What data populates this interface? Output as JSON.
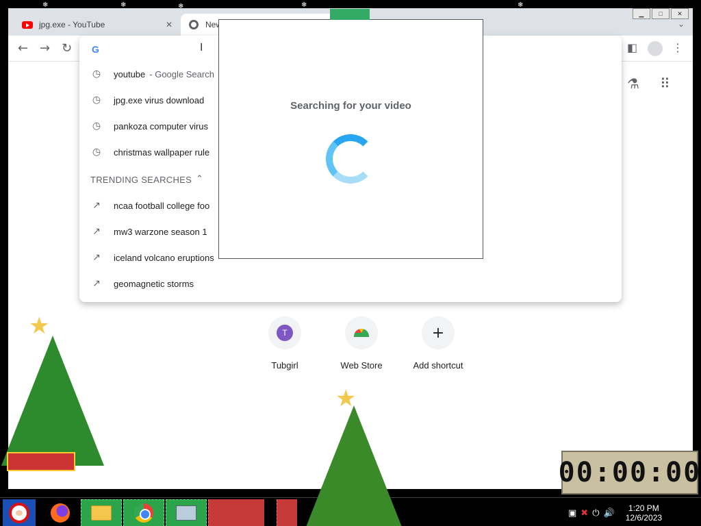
{
  "browser": {
    "tabs": [
      {
        "label": "jpg.exe - YouTube"
      },
      {
        "label": "New"
      }
    ]
  },
  "omnibox": {
    "suggestions": [
      {
        "text": "youtube",
        "sub": "- Google Search"
      },
      {
        "text": "jpg.exe virus download"
      },
      {
        "text": "pankoza computer virus"
      },
      {
        "text": "christmas wallpaper rule"
      }
    ],
    "trending_header": "TRENDING SEARCHES",
    "trending": [
      {
        "text": "ncaa football college foo"
      },
      {
        "text": "mw3 warzone season 1"
      },
      {
        "text": "iceland volcano eruptions"
      },
      {
        "text": "geomagnetic storms"
      }
    ]
  },
  "ntp": {
    "shortcuts": [
      {
        "label": "Tubgirl",
        "initial": "T"
      },
      {
        "label": "Web Store"
      },
      {
        "label": "Add shortcut"
      }
    ]
  },
  "popup": {
    "title": "Searching for your video"
  },
  "timer": {
    "display": "00:00:00"
  },
  "taskbar": {
    "time": "1:20 PM",
    "date": "12/6/2023"
  }
}
